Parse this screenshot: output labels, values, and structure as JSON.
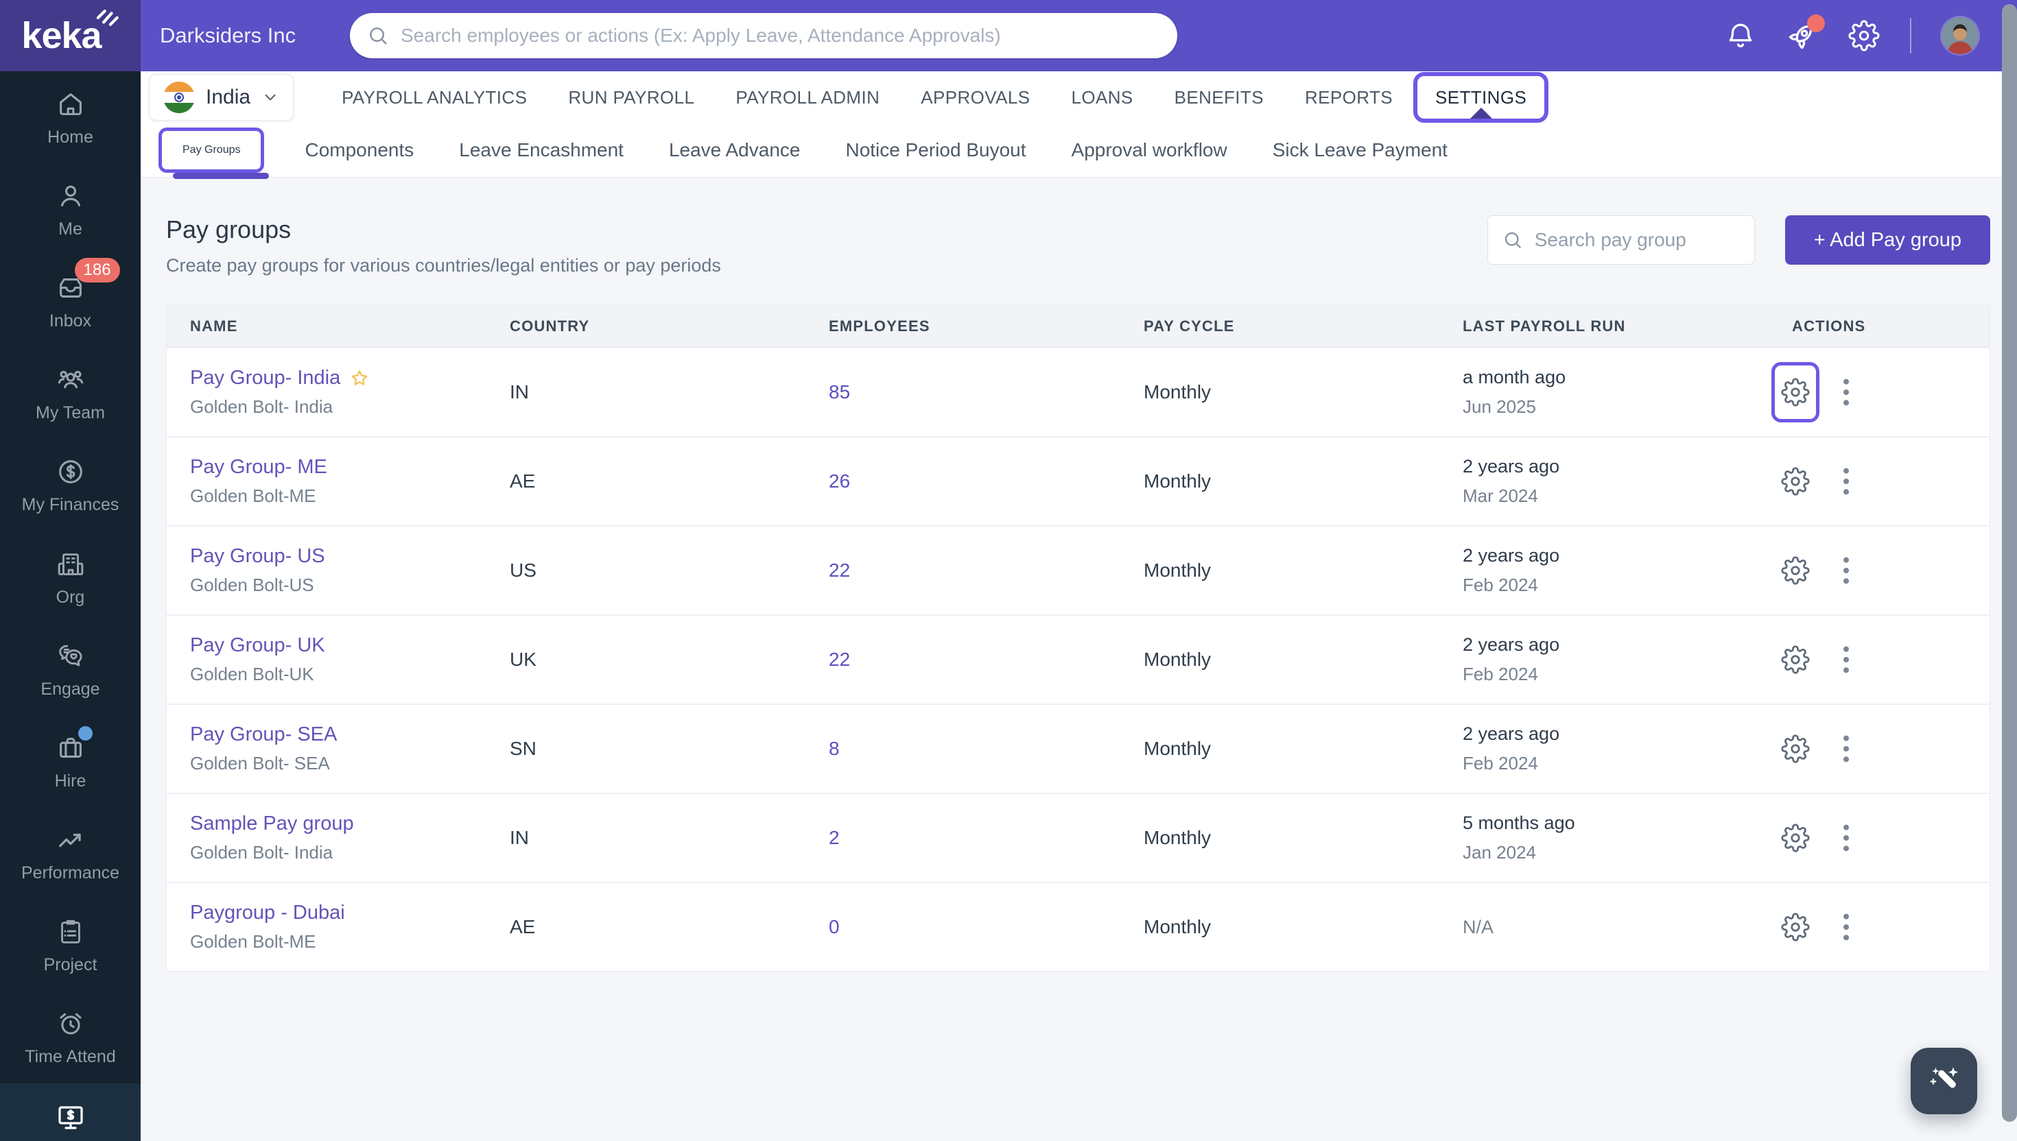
{
  "colors": {
    "topbar_purple": "#5B50C5",
    "logo_purple": "#433A8C",
    "sidebar_navy": "#15222F",
    "annotation_purple": "#6C59E6",
    "link_purple": "#6254B8",
    "button_purple": "#5A4ABF",
    "badge_red": "#EC6F68",
    "hire_dot_blue": "#5FA0DB",
    "star_gold": "#F4BE4F"
  },
  "topbar": {
    "brand": "keka",
    "company": "Darksiders Inc",
    "search_placeholder": "Search employees or actions (Ex: Apply Leave, Attendance Approvals)",
    "icons": [
      "bell-icon",
      "rocket-icon",
      "gear-icon",
      "user-avatar"
    ]
  },
  "sidebar": {
    "items": [
      {
        "label": "Home",
        "icon": "home-icon"
      },
      {
        "label": "Me",
        "icon": "user-icon"
      },
      {
        "label": "Inbox",
        "icon": "inbox-icon",
        "badge": "186"
      },
      {
        "label": "My Team",
        "icon": "team-icon"
      },
      {
        "label": "My Finances",
        "icon": "dollar-circle-icon"
      },
      {
        "label": "Org",
        "icon": "building-icon"
      },
      {
        "label": "Engage",
        "icon": "chat-heart-icon"
      },
      {
        "label": "Hire",
        "icon": "briefcase-icon",
        "dot": true
      },
      {
        "label": "Performance",
        "icon": "trend-up-icon"
      },
      {
        "label": "Project",
        "icon": "clipboard-icon"
      },
      {
        "label": "Time Attend",
        "icon": "alarm-clock-icon"
      },
      {
        "label": "",
        "icon": "payroll-monitor-icon",
        "active": true
      }
    ]
  },
  "nav": {
    "country": "India",
    "tabs": [
      "PAYROLL ANALYTICS",
      "RUN PAYROLL",
      "PAYROLL ADMIN",
      "APPROVALS",
      "LOANS",
      "BENEFITS",
      "REPORTS",
      "SETTINGS"
    ],
    "active_tab": "SETTINGS"
  },
  "subnav": {
    "tabs": [
      "Pay Groups",
      "Components",
      "Leave Encashment",
      "Leave Advance",
      "Notice Period Buyout",
      "Approval workflow",
      "Sick Leave Payment"
    ],
    "active_tab": "Pay Groups"
  },
  "page": {
    "title": "Pay groups",
    "subtitle": "Create pay groups for various countries/legal entities or pay periods",
    "search_placeholder": "Search pay group",
    "add_button_label": "+ Add Pay group"
  },
  "table": {
    "columns": [
      "NAME",
      "COUNTRY",
      "EMPLOYEES",
      "PAY CYCLE",
      "LAST PAYROLL RUN",
      "ACTIONS"
    ],
    "rows": [
      {
        "name": "Pay Group- India",
        "entity": "Golden Bolt- India",
        "country": "IN",
        "employees": "85",
        "pay_cycle": "Monthly",
        "last_run": "a month ago",
        "last_run_date": "Jun 2025",
        "starred": true,
        "annotated": true
      },
      {
        "name": "Pay Group- ME",
        "entity": "Golden Bolt-ME",
        "country": "AE",
        "employees": "26",
        "pay_cycle": "Monthly",
        "last_run": "2 years ago",
        "last_run_date": "Mar 2024"
      },
      {
        "name": "Pay Group- US",
        "entity": "Golden Bolt-US",
        "country": "US",
        "employees": "22",
        "pay_cycle": "Monthly",
        "last_run": "2 years ago",
        "last_run_date": "Feb 2024"
      },
      {
        "name": "Pay Group- UK",
        "entity": "Golden Bolt-UK",
        "country": "UK",
        "employees": "22",
        "pay_cycle": "Monthly",
        "last_run": "2 years ago",
        "last_run_date": "Feb 2024"
      },
      {
        "name": "Pay Group- SEA",
        "entity": "Golden Bolt- SEA",
        "country": "SN",
        "employees": "8",
        "pay_cycle": "Monthly",
        "last_run": "2 years ago",
        "last_run_date": "Feb 2024"
      },
      {
        "name": "Sample Pay group",
        "entity": "Golden Bolt- India",
        "country": "IN",
        "employees": "2",
        "pay_cycle": "Monthly",
        "last_run": "5 months ago",
        "last_run_date": "Jan 2024"
      },
      {
        "name": "Paygroup - Dubai",
        "entity": "Golden Bolt-ME",
        "country": "AE",
        "employees": "0",
        "pay_cycle": "Monthly",
        "last_run": "N/A",
        "last_run_date": ""
      }
    ]
  }
}
